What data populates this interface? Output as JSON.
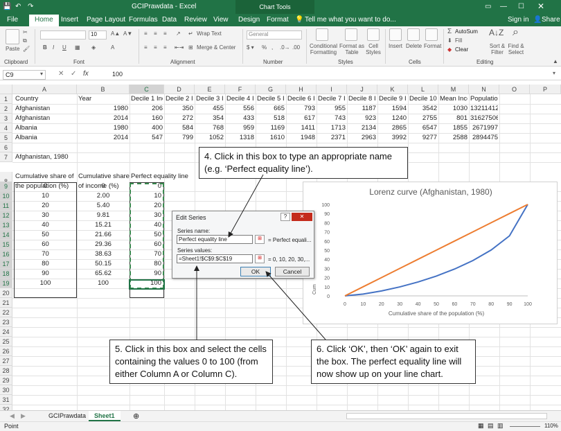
{
  "titlebar": {
    "title": "GCIPrawdata - Excel",
    "context_tab": "Chart Tools",
    "signin": "Sign in",
    "share": "Share"
  },
  "tabs": [
    "File",
    "Home",
    "Insert",
    "Page Layout",
    "Formulas",
    "Data",
    "Review",
    "View",
    "Design",
    "Format"
  ],
  "tell_me": "Tell me what you want to do...",
  "ribbon": {
    "paste": "Paste",
    "font_size": "10",
    "wrap_text": "Wrap Text",
    "merge_center": "Merge & Center",
    "number_format": "General",
    "conditional_formatting": "Conditional Formatting",
    "format_as_table": "Format as Table",
    "cell_styles": "Cell Styles",
    "insert": "Insert",
    "delete": "Delete",
    "format": "Format",
    "autosum": "AutoSum",
    "fill": "Fill",
    "clear": "Clear",
    "sort_filter": "Sort & Filter",
    "find_select": "Find & Select",
    "groups": [
      "Clipboard",
      "Font",
      "Alignment",
      "Number",
      "Styles",
      "Cells",
      "Editing"
    ]
  },
  "formula_bar": {
    "name_box": "C9",
    "fx": "fx",
    "value": "100"
  },
  "sheet": {
    "columns": [
      "A",
      "B",
      "C",
      "D",
      "E",
      "F",
      "G",
      "H",
      "I",
      "J",
      "K",
      "L",
      "M",
      "N",
      "O",
      "P"
    ],
    "rows": [
      "1",
      "2",
      "3",
      "4",
      "5",
      "6",
      "7",
      "8",
      "9",
      "10",
      "11",
      "12",
      "13",
      "14",
      "15",
      "16",
      "17",
      "18",
      "19",
      "20",
      "21",
      "22",
      "23",
      "24",
      "25",
      "26",
      "27",
      "28",
      "29",
      "30",
      "31",
      "32"
    ],
    "header_row": [
      "Country",
      "Year",
      "Decile 1 Inc",
      "Decile 2 In",
      "Decile 3 In",
      "Decile 4 In",
      "Decile 5 In",
      "Decile 6 In",
      "Decile 7 In",
      "Decile 8 In",
      "Decile 9 In",
      "Decile 10 I",
      "Mean Inco",
      "Population"
    ],
    "data_rows": [
      [
        "Afghanistan",
        "1980",
        "206",
        "350",
        "455",
        "556",
        "665",
        "793",
        "955",
        "1187",
        "1594",
        "3542",
        "1030",
        "13211412"
      ],
      [
        "Afghanistan",
        "2014",
        "160",
        "272",
        "354",
        "433",
        "518",
        "617",
        "743",
        "923",
        "1240",
        "2755",
        "801",
        "31627506"
      ],
      [
        "Albania",
        "1980",
        "400",
        "584",
        "768",
        "959",
        "1169",
        "1411",
        "1713",
        "2134",
        "2865",
        "6547",
        "1855",
        "2671997"
      ],
      [
        "Albania",
        "2014",
        "547",
        "799",
        "1052",
        "1318",
        "1610",
        "1948",
        "2371",
        "2963",
        "3992",
        "9277",
        "2588",
        "2894475"
      ]
    ],
    "a7": "Afghanistan, 1980",
    "a8": [
      "Cumulative share of",
      "the population (%)"
    ],
    "b8": [
      "Cumulative share",
      "of income (%)"
    ],
    "c8": "Perfect equality line",
    "col_a": [
      "0",
      "10",
      "20",
      "30",
      "40",
      "50",
      "60",
      "70",
      "80",
      "90",
      "100"
    ],
    "col_b": [
      "0",
      "2.00",
      "5.40",
      "9.81",
      "15.21",
      "21.66",
      "29.36",
      "38.63",
      "50.15",
      "65.62",
      "100"
    ],
    "col_c": [
      "0",
      "10",
      "20",
      "30",
      "40",
      "50",
      "60",
      "70",
      "80",
      "90",
      "100"
    ]
  },
  "dialog": {
    "title": "Edit Series",
    "help": "?",
    "close": "✕",
    "series_name_label": "Series name:",
    "series_name_value": "Perfect equality line",
    "series_name_preview": "= Perfect equali...",
    "series_values_label": "Series values:",
    "series_values_value": "=Sheet1!$C$9:$C$19",
    "series_values_preview": "= 0, 10, 20, 30,...",
    "ok": "OK",
    "cancel": "Cancel"
  },
  "callouts": {
    "c4": "4. Click in this box to type an appropriate name (e.g. ‘Perfect equality line’).",
    "c5": "5. Click in this box and select the cells containing the values 0 to 100 (from either Column A or Column C).",
    "c6": "6. Click ‘OK’, then ‘OK’ again to exit the box. The perfect equality line will now show up on your line chart."
  },
  "chart_data": {
    "type": "line",
    "title": "Lorenz curve (Afghanistan, 1980)",
    "xlabel": "Cumulative share of the population (%)",
    "ylabel": "Cum",
    "categories": [
      "0",
      "10",
      "20",
      "30",
      "40",
      "50",
      "60",
      "70",
      "80",
      "90",
      "100"
    ],
    "series": [
      {
        "values": [
          0,
          2.0,
          5.4,
          9.81,
          15.21,
          21.66,
          29.36,
          38.63,
          50.15,
          65.62,
          100
        ],
        "color": "#4472c4"
      },
      {
        "values": [
          0,
          10,
          20,
          30,
          40,
          50,
          60,
          70,
          80,
          90,
          100
        ],
        "color": "#ed7d31"
      }
    ],
    "y_ticks": [
      "0",
      "10",
      "20",
      "30",
      "40",
      "50",
      "60",
      "70",
      "80",
      "90",
      "100"
    ],
    "ylim": [
      0,
      100
    ]
  },
  "sheet_tabs": [
    "GCIPrawdata",
    "Sheet1"
  ],
  "add_sheet": "⊕",
  "status": {
    "mode": "Point",
    "zoom": "110%"
  }
}
